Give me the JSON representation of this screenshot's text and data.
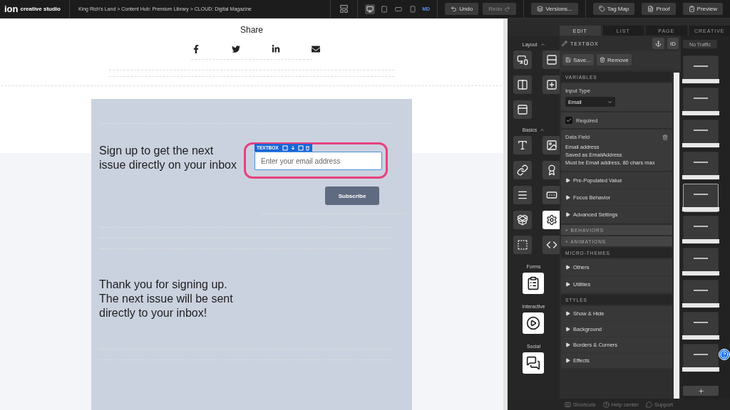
{
  "topbar": {
    "logo": "ion",
    "brand": "creative studio",
    "breadcrumb": "King Rich's Land > Content Hub: Premium Library > CLOUD: Digital Magazine",
    "devices": [
      {
        "kind": "desktop",
        "selected": true
      },
      {
        "kind": "tablet",
        "selected": false
      },
      {
        "kind": "landscape",
        "selected": false
      },
      {
        "kind": "phone",
        "selected": false
      }
    ],
    "size_label": "MD",
    "buttons": [
      {
        "kind": "undo",
        "label": "Undo",
        "disabled": false
      },
      {
        "kind": "redo",
        "label": "Redo",
        "disabled": true
      },
      {
        "kind": "versions",
        "label": "Versions...",
        "disabled": false
      },
      {
        "kind": "tagmap",
        "label": "Tag Map",
        "disabled": false
      },
      {
        "kind": "proof",
        "label": "Proof",
        "disabled": false
      },
      {
        "kind": "preview",
        "label": "Preview",
        "disabled": false
      }
    ]
  },
  "canvas": {
    "share_title": "Share",
    "social": [
      {
        "kind": "facebook"
      },
      {
        "kind": "twitter"
      },
      {
        "kind": "linkedin"
      },
      {
        "kind": "email"
      }
    ],
    "signup_lines": [
      "Sign up to get the next",
      "issue directly on your inbox"
    ],
    "element_tag": "TEXTBOX",
    "email_field": {
      "placeholder": "Enter your email address",
      "selected": true
    },
    "subscribe": "Subscribe",
    "thanks_lines": [
      "Thank you for signing up.",
      "The next issue will be sent",
      "directly to your inbox!"
    ]
  },
  "panel": {
    "tabs": [
      {
        "label": "EDIT",
        "selected": true
      },
      {
        "label": "LIST",
        "selected": false
      },
      {
        "label": "PAGE",
        "selected": false
      },
      {
        "label": "CREATIVE",
        "selected": false
      }
    ],
    "palette": [
      {
        "title": "Layout",
        "items": [
          {
            "kind": "responsive"
          },
          {
            "kind": "rows"
          },
          {
            "kind": "columns"
          },
          {
            "kind": "container"
          },
          {
            "kind": "overlay"
          }
        ]
      },
      {
        "title": "Basics",
        "items": [
          {
            "kind": "text"
          },
          {
            "kind": "image"
          },
          {
            "kind": "link"
          },
          {
            "kind": "badge"
          },
          {
            "kind": "list"
          },
          {
            "kind": "input"
          },
          {
            "kind": "import"
          },
          {
            "kind": "settings"
          },
          {
            "kind": "placeholder"
          },
          {
            "kind": "code"
          }
        ]
      },
      {
        "title": "Forms",
        "items": [
          {
            "kind": "form"
          }
        ]
      },
      {
        "title": "Interactive",
        "items": [
          {
            "kind": "video"
          }
        ]
      },
      {
        "title": "Social",
        "items": [
          {
            "kind": "chat"
          }
        ]
      }
    ],
    "element": {
      "title": "TEXTBOX",
      "id_button": "ID",
      "save": "Save...",
      "remove": "Remove"
    },
    "variables": {
      "title": "VARIABLES",
      "input_type_label": "Input Type",
      "input_type": "Email",
      "required": {
        "label": "Required",
        "checked": true
      },
      "data_field": {
        "title": "Data Field",
        "lines": [
          "Email address",
          "Saved as EmailAddress",
          "Must be Email address, 80 chars max"
        ]
      },
      "options": [
        "Pre-Populated Value",
        "Focus Behavior",
        "Advanced Settings"
      ]
    },
    "bars": [
      "+ BEHAVIORS",
      "+ ANIMATIONS"
    ],
    "micro_themes": {
      "title": "MICRO-THEMES",
      "items": [
        "Others",
        "Utilities"
      ]
    },
    "styles": {
      "title": "STYLES",
      "items": [
        "Show & Hide",
        "Background",
        "Borders & Corners",
        "Effects"
      ]
    },
    "thumbnails": {
      "traffic": "No Traffic",
      "pages": [
        {
          "selected": false
        },
        {
          "selected": false
        },
        {
          "selected": false
        },
        {
          "selected": false
        },
        {
          "selected": true
        },
        {
          "selected": false
        },
        {
          "selected": false
        },
        {
          "selected": false
        },
        {
          "selected": false
        },
        {
          "selected": false
        }
      ]
    },
    "footer": [
      {
        "kind": "shortcuts",
        "label": "Shortcuts"
      },
      {
        "kind": "help",
        "label": "Help center"
      },
      {
        "kind": "support",
        "label": "Support"
      }
    ]
  }
}
